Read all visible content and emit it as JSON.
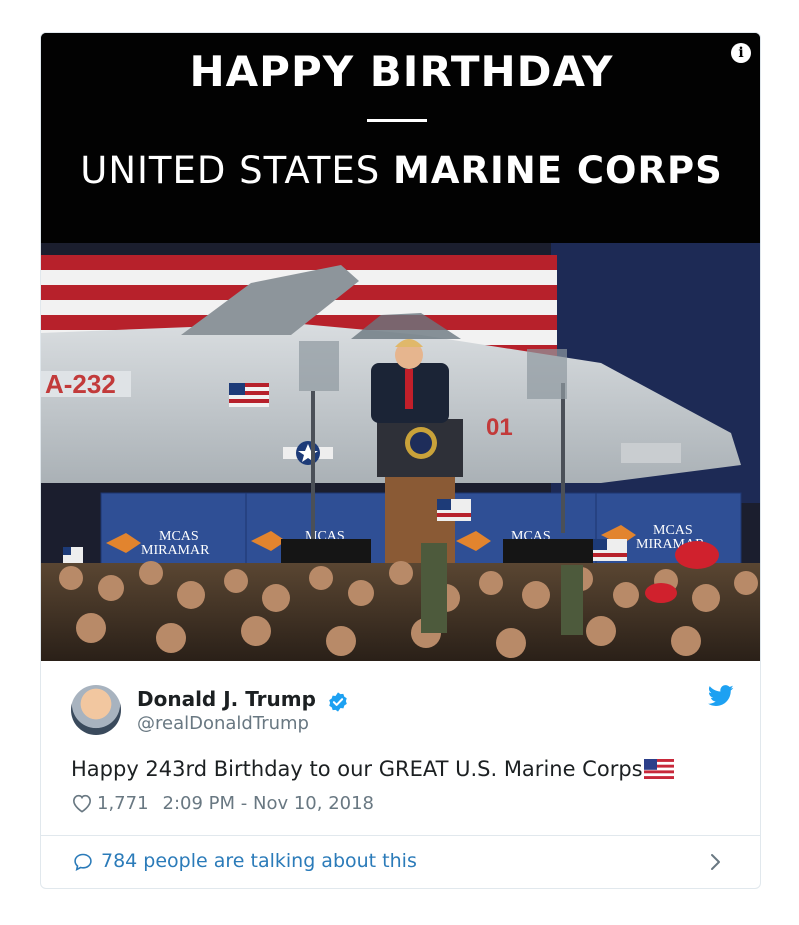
{
  "media": {
    "headline": "HAPPY BIRTHDAY",
    "subhead_light": "UNITED STATES",
    "subhead_bold": "MARINE CORPS",
    "info_icon": "i",
    "jet_tail_number": "A-232",
    "jet_nose_number": "01",
    "banner_text_line1": "MCAS",
    "banner_text_line2": "MIRAMAR"
  },
  "tweet": {
    "author_name": "Donald J. Trump",
    "author_handle": "@realDonaldTrump",
    "text": "Happy 243rd Birthday to our GREAT U.S. Marine Corps",
    "likes": "1,771",
    "timestamp": "2:09 PM - Nov 10, 2018",
    "talking": "784 people are talking about this"
  },
  "colors": {
    "twitter_blue": "#1da1f2",
    "link_blue": "#2b7bb9",
    "muted_gray": "#697882"
  },
  "icons": [
    "info-icon",
    "verified-badge-icon",
    "twitter-bird-icon",
    "heart-icon",
    "speech-bubble-icon",
    "chevron-right-icon",
    "us-flag-emoji"
  ]
}
